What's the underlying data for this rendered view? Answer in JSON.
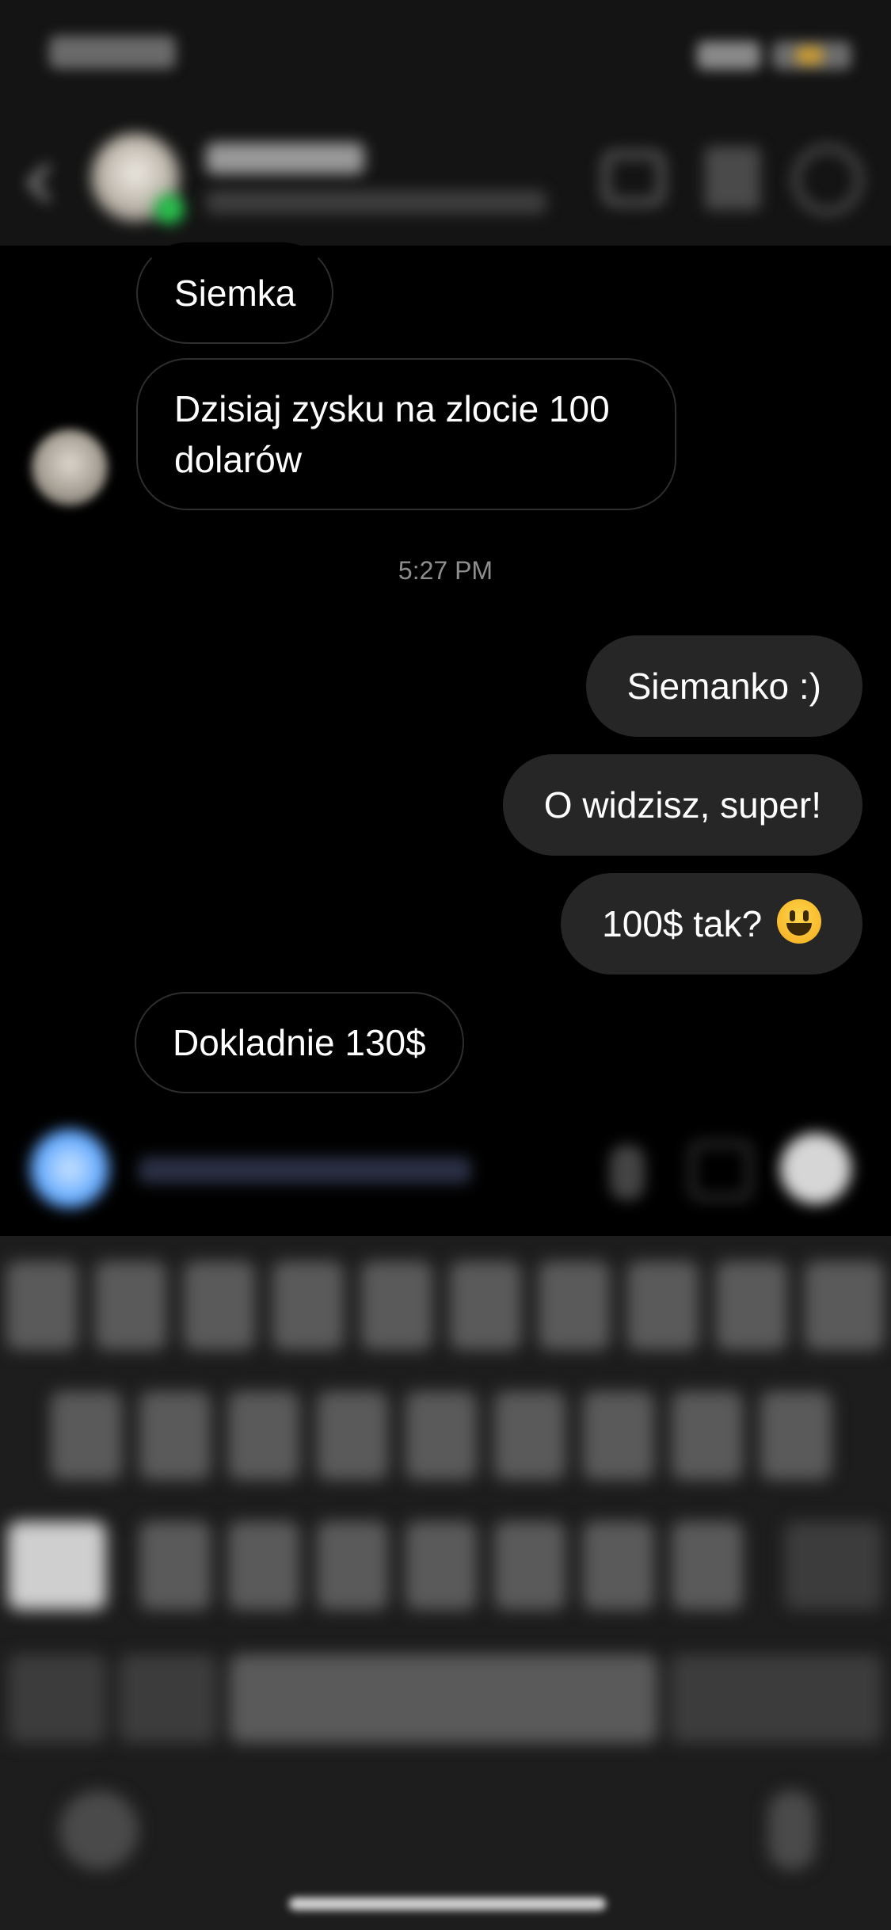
{
  "messages": {
    "incoming_1": "Siemka",
    "incoming_2": "Dzisiaj zysku na zlocie 100 dolarów",
    "timestamp": "5:27 PM",
    "outgoing_1": "Siemanko :)",
    "outgoing_2": "O widzisz, super!",
    "outgoing_3": "100$ tak?",
    "incoming_3": "Dokladnie 130$"
  },
  "icons": {
    "back": "chevron-left-icon",
    "video": "video-camera-icon",
    "flag": "flag-icon",
    "info": "info-icon",
    "camera": "camera-icon",
    "mic": "microphone-icon",
    "gallery": "gallery-icon",
    "sticker": "sticker-icon"
  },
  "colors": {
    "background": "#000000",
    "outgoing_bubble": "#262626",
    "incoming_border": "#2e2e2e",
    "timestamp": "#8e8e8e",
    "online": "#27c24c",
    "camera_button": "#6aaeff"
  }
}
